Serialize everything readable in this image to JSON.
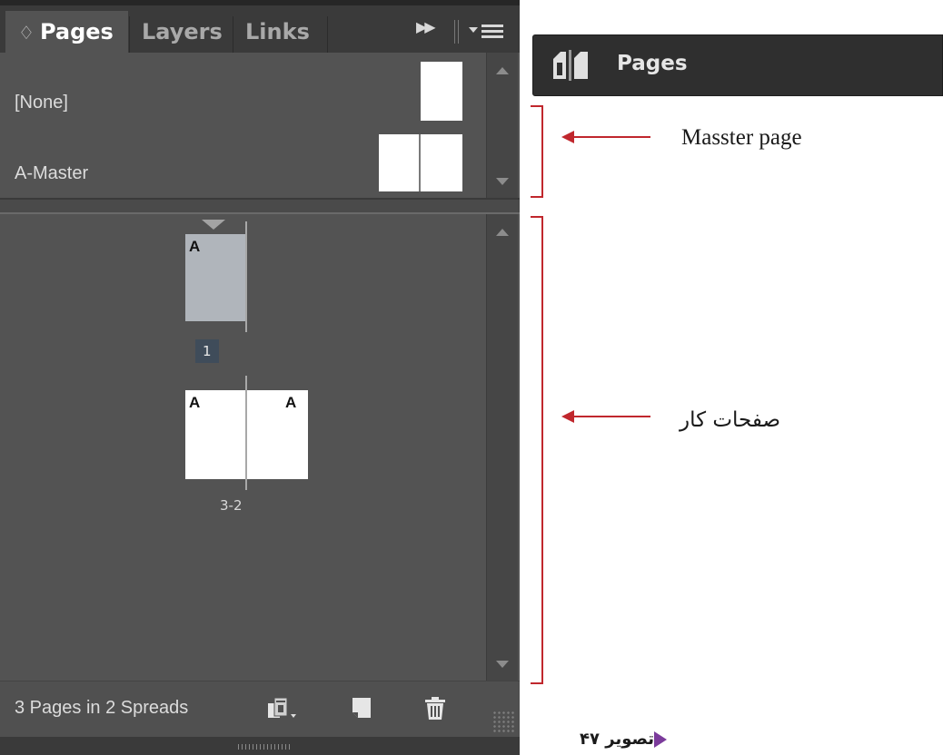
{
  "panel": {
    "tabs": [
      {
        "label": "Pages",
        "active": true,
        "chevron": "♢"
      },
      {
        "label": "Layers",
        "active": false
      },
      {
        "label": "Links",
        "active": false
      }
    ],
    "masters": [
      {
        "label": "[None]"
      },
      {
        "label": "A-Master"
      }
    ],
    "pages": [
      {
        "prefix": "A",
        "number": "1",
        "selected": true
      },
      {
        "spread_prefixes": [
          "A",
          "A"
        ],
        "number": "3-2",
        "selected": false
      }
    ],
    "status": "3 Pages in 2 Spreads"
  },
  "collapsed_panel": {
    "label": "Pages"
  },
  "annotations": {
    "master": "Masster page",
    "pages": "صفحات کار"
  },
  "caption": "تصویر ۴۷",
  "colors": {
    "panel_bg": "#535353",
    "tabbar_bg": "#3a3a3a",
    "selected_page": "#b0b5bb",
    "annotation_red": "#c0272d",
    "caption_triangle": "#7b3b9b"
  }
}
